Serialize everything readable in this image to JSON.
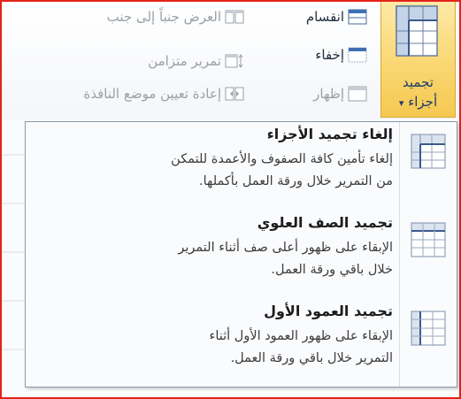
{
  "ribbon": {
    "freeze_panes": {
      "label_line1": "تجميد",
      "label_line2": "أجزاء",
      "dropdown_glyph": "▾",
      "icon": "freeze-panes-icon"
    },
    "split": {
      "label": "انقسام",
      "icon": "split-icon"
    },
    "hide": {
      "label": "إخفاء",
      "icon": "hide-window-icon"
    },
    "unhide": {
      "label": "إظهار",
      "icon": "unhide-window-icon"
    },
    "view_side_by_side": {
      "label": "العرض جنباً إلى جنب",
      "icon": "side-by-side-icon"
    },
    "synchronous_scrolling": {
      "label": "تمرير متزامن",
      "icon": "synchronous-scroll-icon"
    },
    "reset_window_position": {
      "label": "إعادة تعيين موضع النافذة",
      "icon": "reset-window-position-icon"
    }
  },
  "menu": {
    "items": [
      {
        "title": "إلغاء تجميد الأجزاء",
        "desc_lines": [
          "إلغاء تأمين كافة الصفوف والأعمدة للتمكن",
          "من التمرير خلال ورقة العمل بأكملها."
        ],
        "icon": "unfreeze-panes-icon"
      },
      {
        "title": "تجميد الصف العلوي",
        "desc_lines": [
          "الإبقاء على ظهور أعلى صف أثناء التمرير",
          "خلال باقي ورقة العمل."
        ],
        "icon": "freeze-top-row-icon"
      },
      {
        "title": "تجميد العمود الأول",
        "desc_lines": [
          "الإبقاء على ظهور العمود الأول أثناء",
          "التمرير خلال باقي ورقة العمل."
        ],
        "icon": "freeze-first-column-icon"
      }
    ]
  },
  "colors": {
    "highlight_border": "#e2231a",
    "freeze_button_bg": "#f9d772",
    "disabled_text": "#9aa0a6",
    "menu_border": "#8a98ae"
  }
}
